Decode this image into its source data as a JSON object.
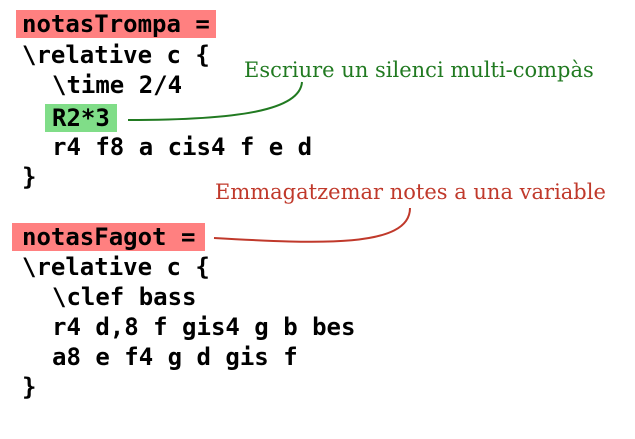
{
  "colors": {
    "variable_highlight": "#ff8080",
    "rest_highlight": "#80dd88",
    "annotation_green": "#217a21",
    "annotation_red": "#c0392b"
  },
  "block1": {
    "var_name": "notasTrompa =",
    "relative": "\\relative c {",
    "time": "\\time 2/4",
    "rest": "R2*3",
    "notes": "r4 f8 a cis4 f e d",
    "close": "}"
  },
  "block2": {
    "var_name": "notasFagot =",
    "relative": "\\relative c {",
    "clef": "\\clef bass",
    "notes1": "r4 d,8 f gis4 g b bes",
    "notes2": "a8 e f4 g d gis f",
    "close": "}"
  },
  "annotations": {
    "multirest": "Escriure un silenci multi-compàs",
    "variable": "Emmagatzemar notes a una variable"
  }
}
